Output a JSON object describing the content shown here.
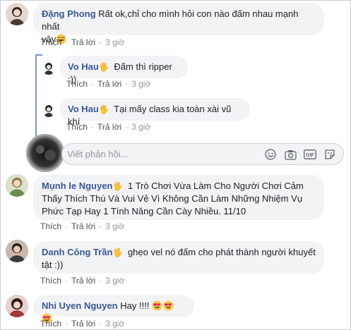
{
  "actions": {
    "like": "Thích",
    "reply": "Trả lời",
    "separator": "·"
  },
  "comments": [
    {
      "author": "Đặng Phong",
      "text": " Rất ok,chỉ cho mình hỏi con nào đấm nhau mạnh nhất",
      "text2": "vậy",
      "time": "3 giờ"
    },
    {
      "author": "Vo Hau",
      "text": " Đấm thì ripper :))",
      "time": "3 giờ"
    },
    {
      "author": "Vo Hau",
      "text": " Tại mấy class kia toàn xài vũ khí",
      "time": "3 giờ"
    },
    {
      "author": "Mụnh le Nguyen",
      "text": " 1 Trò Chơi Vừa Làm Cho Người Chơi Cảm",
      "text2": "Thấy Thích Thú Và Vui Vẻ Vì Không Cần Làm Những Nhiệm Vụ",
      "text3": "Phức Tạp Hay 1 Tính Năng Cần Cày Nhiều. 11/10",
      "time": "3 giờ"
    },
    {
      "author": "Danh Công Trần",
      "text": " ghẹo vel nó đấm cho phát thành người khuyết",
      "text2": "tật :))",
      "time": "3 giờ"
    },
    {
      "author": "Nhi Uyen Nguyen",
      "text": " Hay !!!! ",
      "time": "3 giờ"
    }
  ],
  "reply_box": {
    "placeholder": "Viết phản hồi..."
  },
  "icons": {
    "wave": "waving-hand-icon",
    "emoji": "smiley-icon",
    "camera": "camera-icon",
    "gif": "gif-icon",
    "sticker": "sticker-icon",
    "grin_sweat": "grinning-sweat-emoji",
    "heart_eyes": "heart-eyes-emoji"
  },
  "colors": {
    "author": "#385898",
    "bubble": "#f2f3f5",
    "thread": "#7a97d1"
  }
}
